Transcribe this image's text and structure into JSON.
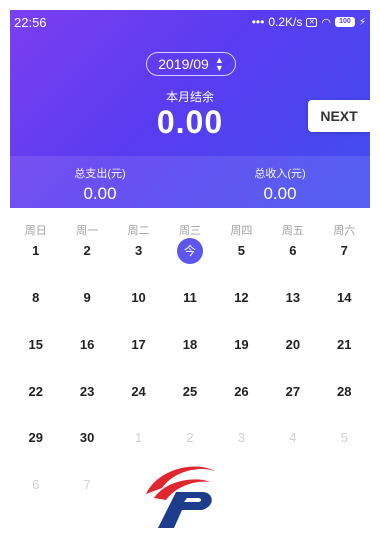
{
  "status_bar": {
    "time": "22:56",
    "network_speed": "0.2K/s",
    "battery": "100"
  },
  "header": {
    "month": "2019/09",
    "balance_label": "本月结余",
    "balance_value": "0.00",
    "expense_label": "总支出(元)",
    "expense_value": "0.00",
    "income_label": "总收入(元)",
    "income_value": "0.00",
    "next_label": "NEXT"
  },
  "calendar": {
    "weekdays": [
      "周日",
      "周一",
      "周二",
      "周三",
      "周四",
      "周五",
      "周六"
    ],
    "weeks": [
      [
        "1",
        "2",
        "3",
        "今",
        "5",
        "6",
        "7"
      ],
      [
        "8",
        "9",
        "10",
        "11",
        "12",
        "13",
        "14"
      ],
      [
        "15",
        "16",
        "17",
        "18",
        "19",
        "20",
        "21"
      ],
      [
        "22",
        "23",
        "24",
        "25",
        "26",
        "27",
        "28"
      ],
      [
        "29",
        "30",
        "1",
        "2",
        "3",
        "4",
        "5"
      ],
      [
        "6",
        "7",
        "",
        "",
        "",
        "",
        ""
      ]
    ],
    "today": {
      "week": 0,
      "day": 3
    },
    "faded": [
      [
        4,
        2
      ],
      [
        4,
        3
      ],
      [
        4,
        4
      ],
      [
        4,
        5
      ],
      [
        4,
        6
      ],
      [
        5,
        0
      ],
      [
        5,
        1
      ]
    ]
  },
  "colors": {
    "header_gradient_start": "#7b3ff0",
    "header_gradient_end": "#3f4ff0",
    "today_badge": "#5b56ec",
    "logo_red": "#e0272f",
    "logo_blue": "#1d3c8c"
  }
}
